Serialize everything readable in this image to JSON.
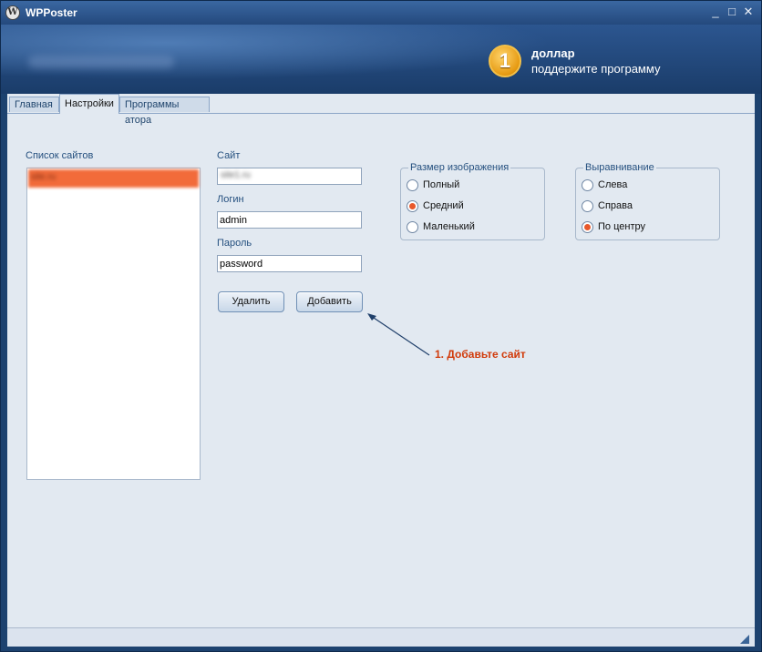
{
  "window": {
    "title": "WPPoster",
    "controls": [
      "_",
      "□",
      "✕"
    ]
  },
  "banner": {
    "badge_number": "1",
    "title": "доллар",
    "subtitle": "поддержите программу"
  },
  "tabs": [
    {
      "label": "Главная",
      "active": false
    },
    {
      "label": "Настройки",
      "active": true
    },
    {
      "label": "Программы атора",
      "active": false
    }
  ],
  "sites": {
    "label": "Список сайтов",
    "items": [
      "site.ru"
    ]
  },
  "form": {
    "site_label": "Сайт",
    "site_value": "site1.ru",
    "login_label": "Логин",
    "login_value": "admin",
    "password_label": "Пароль",
    "password_value": "password"
  },
  "buttons": {
    "delete": "Удалить",
    "add": "Добавить"
  },
  "image_size": {
    "title": "Размер изображения",
    "options": [
      "Полный",
      "Средний",
      "Маленький"
    ],
    "selected": "Средний"
  },
  "alignment": {
    "title": "Выравнивание",
    "options": [
      "Слева",
      "Справа",
      "По центру"
    ],
    "selected": "По центру"
  },
  "annotation": "1. Добавьте сайт",
  "colors": {
    "accent": "#e8582b",
    "annotation": "#d13a0a",
    "title_bar": "#24497d"
  }
}
